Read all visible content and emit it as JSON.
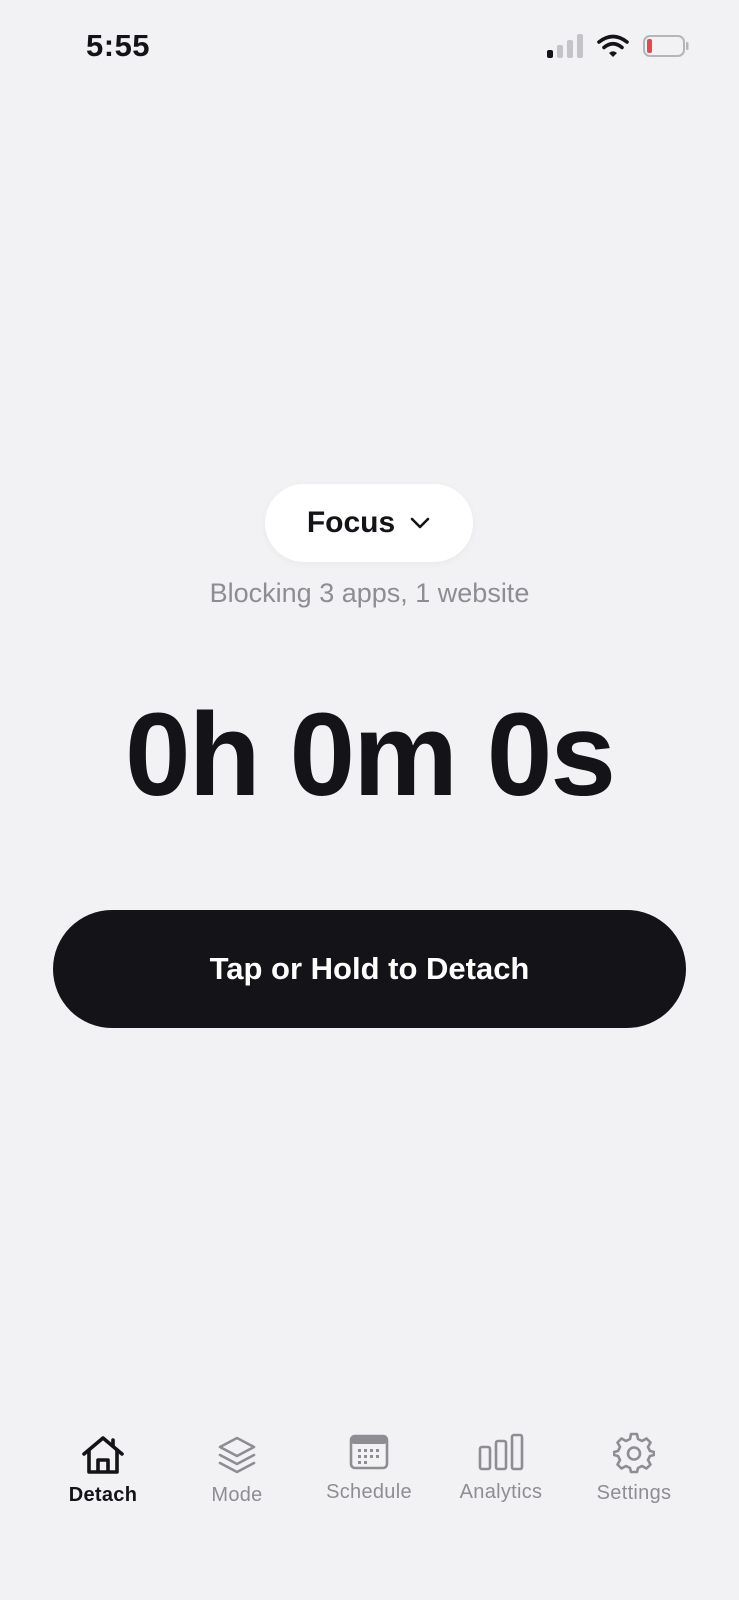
{
  "status_bar": {
    "time": "5:55",
    "icons": [
      "signal-icon",
      "wifi-icon",
      "battery-low-icon"
    ]
  },
  "mode_selector": {
    "label": "Focus",
    "icon": "chevron-down-icon"
  },
  "blocking_summary": "Blocking 3 apps, 1 website",
  "timer": "0h 0m 0s",
  "detach_button_label": "Tap or Hold to Detach",
  "tabs": [
    {
      "label": "Detach",
      "icon": "home-icon",
      "active": true
    },
    {
      "label": "Mode",
      "icon": "layers-icon",
      "active": false
    },
    {
      "label": "Schedule",
      "icon": "calendar-icon",
      "active": false
    },
    {
      "label": "Analytics",
      "icon": "bar-chart-icon",
      "active": false
    },
    {
      "label": "Settings",
      "icon": "gear-icon",
      "active": false
    }
  ],
  "colors": {
    "background": "#f2f2f5",
    "primary": "#141418",
    "muted": "#8d8d93",
    "battery_low": "#e5484d"
  }
}
